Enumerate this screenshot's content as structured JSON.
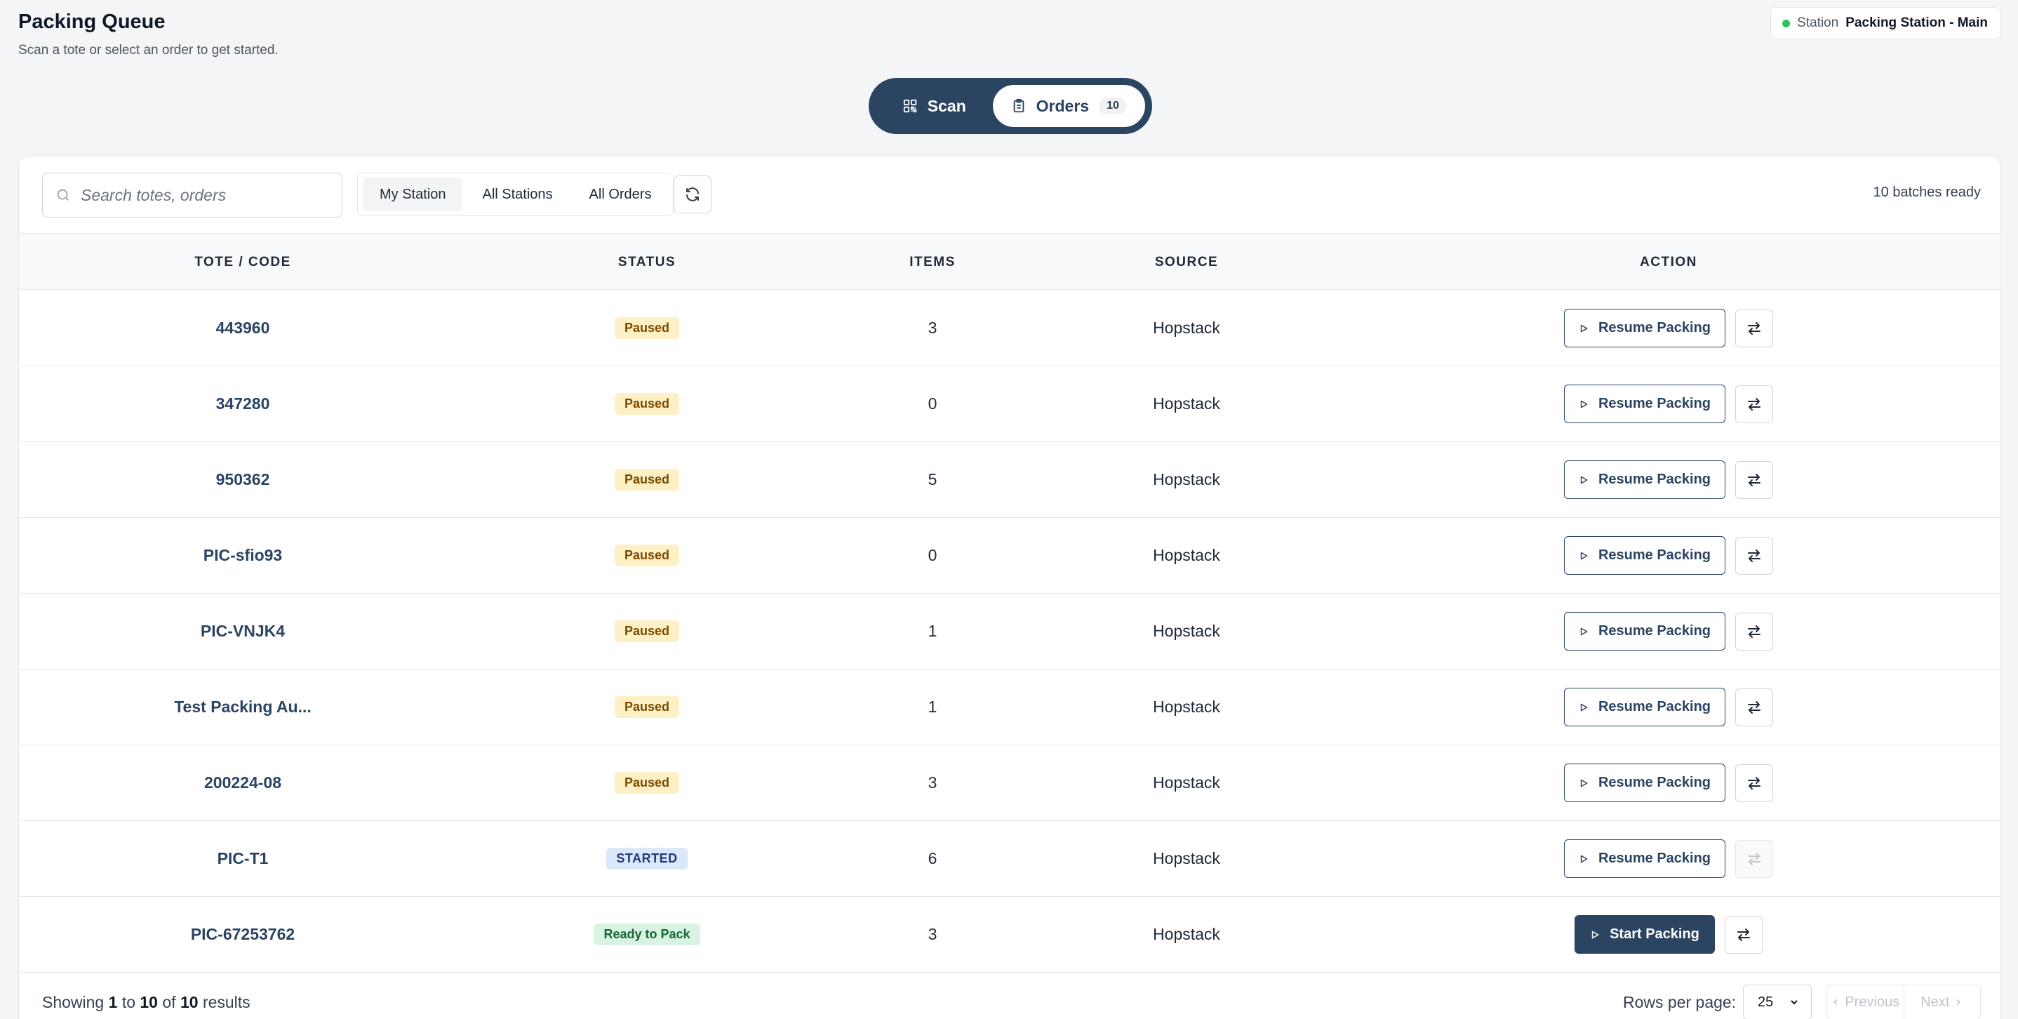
{
  "header": {
    "title": "Packing Queue",
    "subtitle": "Scan a tote or select an order to get started."
  },
  "station": {
    "label": "Station",
    "name": "Packing Station - Main",
    "status_color": "#22c55e"
  },
  "mode_switch": {
    "scan_label": "Scan",
    "orders_label": "Orders",
    "orders_count": "10",
    "active": "Orders"
  },
  "toolbar": {
    "search_placeholder": "Search totes, orders",
    "tabs": [
      "My Station",
      "All Stations",
      "All Orders"
    ],
    "active_tab": "My Station",
    "batches_ready": "10 batches ready"
  },
  "table": {
    "columns": [
      "TOTE / CODE",
      "STATUS",
      "ITEMS",
      "SOURCE",
      "ACTION"
    ],
    "rows": [
      {
        "code": "443960",
        "status": "Paused",
        "items": "3",
        "source": "Hopstack",
        "action": "Resume Packing"
      },
      {
        "code": "347280",
        "status": "Paused",
        "items": "0",
        "source": "Hopstack",
        "action": "Resume Packing"
      },
      {
        "code": "950362",
        "status": "Paused",
        "items": "5",
        "source": "Hopstack",
        "action": "Resume Packing"
      },
      {
        "code": "PIC-sfio93",
        "status": "Paused",
        "items": "0",
        "source": "Hopstack",
        "action": "Resume Packing"
      },
      {
        "code": "PIC-VNJK4",
        "status": "Paused",
        "items": "1",
        "source": "Hopstack",
        "action": "Resume Packing"
      },
      {
        "code": "Test Packing Au...",
        "status": "Paused",
        "items": "1",
        "source": "Hopstack",
        "action": "Resume Packing"
      },
      {
        "code": "200224-08",
        "status": "Paused",
        "items": "3",
        "source": "Hopstack",
        "action": "Resume Packing"
      },
      {
        "code": "PIC-T1",
        "status": "STARTED",
        "items": "6",
        "source": "Hopstack",
        "action": "Resume Packing"
      },
      {
        "code": "PIC-67253762",
        "status": "Ready to Pack",
        "items": "3",
        "source": "Hopstack",
        "action": "Start Packing"
      }
    ]
  },
  "footer": {
    "showing_prefix": "Showing",
    "from": "1",
    "to_word": "to",
    "to": "10",
    "of_word": "of",
    "total": "10",
    "results_word": "results",
    "rows_per_page_label": "Rows per page:",
    "rows_per_page_value": "25",
    "previous_label": "Previous",
    "next_label": "Next"
  },
  "colors": {
    "brand_navy": "#2b4462",
    "paused_bg": "#fdf0c4",
    "started_bg": "#dbe7fb",
    "ready_bg": "#d8f3e1"
  }
}
